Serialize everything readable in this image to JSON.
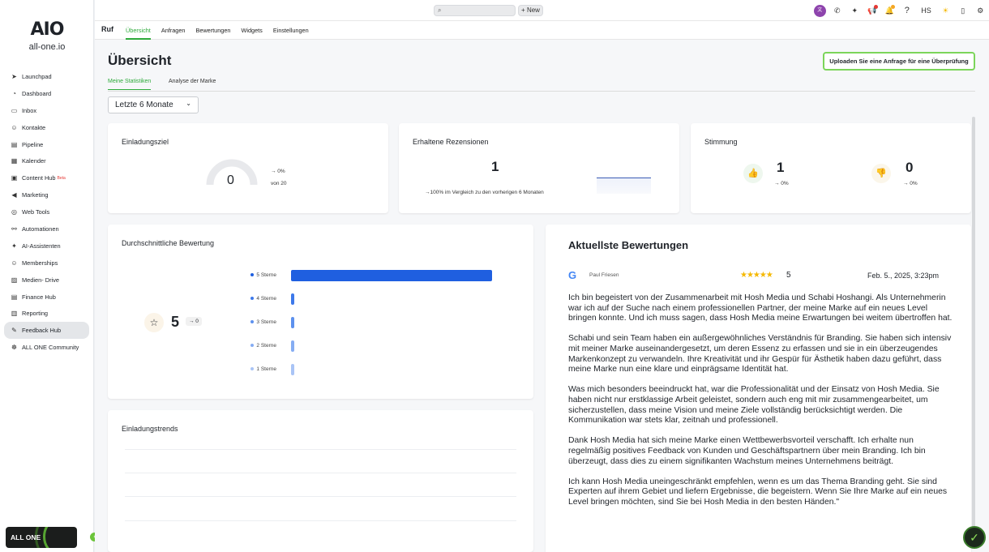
{
  "brand": {
    "logo_mark": "AIO",
    "logo_sub": "all-one.io"
  },
  "sidebar": {
    "items": [
      {
        "label": "Launchpad",
        "icon": "rocket-icon"
      },
      {
        "label": "Dashboard",
        "icon": "gauge-icon"
      },
      {
        "label": "Inbox",
        "icon": "chat-icon"
      },
      {
        "label": "Kontakte",
        "icon": "people-icon"
      },
      {
        "label": "Pipeline",
        "icon": "pipeline-icon"
      },
      {
        "label": "Kalender",
        "icon": "calendar-icon"
      },
      {
        "label": "Content Hub",
        "icon": "content-icon",
        "badge": "Beta"
      },
      {
        "label": "Marketing",
        "icon": "megaphone-icon"
      },
      {
        "label": "Web Tools",
        "icon": "globe-icon"
      },
      {
        "label": "Automationen",
        "icon": "automation-icon"
      },
      {
        "label": "AI-Assistenten",
        "icon": "sparkle-icon"
      },
      {
        "label": "Memberships",
        "icon": "members-icon"
      },
      {
        "label": "Medien- Drive",
        "icon": "image-icon"
      },
      {
        "label": "Finance Hub",
        "icon": "finance-icon"
      },
      {
        "label": "Reporting",
        "icon": "report-icon"
      },
      {
        "label": "Feedback Hub",
        "icon": "feedback-icon",
        "active": true
      },
      {
        "label": "ALL ONE Community",
        "icon": "community-icon"
      }
    ],
    "banner": "ALL ONE"
  },
  "topbar": {
    "new_label": "+ New",
    "user_initials": "HS"
  },
  "subnav": {
    "title": "Ruf",
    "tabs": [
      "Übersicht",
      "Anfragen",
      "Bewertungen",
      "Widgets",
      "Einstellungen"
    ]
  },
  "page": {
    "title": "Übersicht",
    "upload_label": "Uploaden Sie eine Anfrage für eine Überprüfung",
    "tabs": [
      "Meine Statistiken",
      "Analyse der Marke"
    ],
    "period": "Letzte 6 Monate"
  },
  "cards": {
    "invite": {
      "title": "Einladungsziel",
      "value": "0",
      "trend": "→ 0%",
      "of": "von 20",
      "progress": 0
    },
    "received": {
      "title": "Erhaltene Rezensionen",
      "value": "1",
      "compare": "→100% im Vergleich zu den vorherigen 6 Monaten"
    },
    "mood": {
      "title": "Stimmung",
      "positive": "1",
      "positive_trend": "→ 0%",
      "negative": "0",
      "negative_trend": "→ 0%"
    },
    "avg": {
      "title": "Durchschnittliche Bewertung",
      "value": "5",
      "trend": "→ 0"
    },
    "trends": {
      "title": "Einladungstrends"
    }
  },
  "chart_data": {
    "type": "bar",
    "categories": [
      "5 Sterne",
      "4 Sterne",
      "3 Sterne",
      "2 Sterne",
      "1 Sterne"
    ],
    "values": [
      1,
      0,
      0,
      0,
      0
    ],
    "colors": [
      "#1f5fe0",
      "#3d79ea",
      "#5d91ee",
      "#86adf3",
      "#a9c4f6"
    ]
  },
  "review": {
    "title": "Aktuellste Bewertungen",
    "author": "Paul Friesen",
    "stars": "★★★★★",
    "score": "5",
    "date": "Feb. 5., 2025, 3:23pm",
    "paragraphs": [
      "Ich bin begeistert von der Zusammenarbeit mit Hosh Media und Schabi Hoshangi. Als Unternehmerin war ich auf der Suche nach einem professionellen Partner, der meine Marke auf ein neues Level bringen konnte. Und ich muss sagen, dass Hosh Media meine Erwartungen bei weitem übertroffen hat.",
      "Schabi und sein Team haben ein außergewöhnliches Verständnis für Branding. Sie haben sich intensiv mit meiner Marke auseinandergesetzt, um deren Essenz zu erfassen und sie in ein überzeugendes Markenkonzept zu verwandeln. Ihre Kreativität und ihr Gespür für Ästhetik haben dazu geführt, dass meine Marke nun eine klare und einprägsame Identität hat.",
      "Was mich besonders beeindruckt hat, war die Professionalität und der Einsatz von Hosh Media. Sie haben nicht nur erstklassige Arbeit geleistet, sondern auch eng mit mir zusammengearbeitet, um sicherzustellen, dass meine Vision und meine Ziele vollständig berücksichtigt werden. Die Kommunikation war stets klar, zeitnah und professionell.",
      "Dank Hosh Media hat sich meine Marke einen Wettbewerbsvorteil verschafft. Ich erhalte nun regelmäßig positives Feedback von Kunden und Geschäftspartnern über mein Branding. Ich bin überzeugt, dass dies zu einem signifikanten Wachstum meines Unternehmens beiträgt.",
      "Ich kann Hosh Media uneingeschränkt empfehlen, wenn es um das Thema Branding geht. Sie sind Experten auf ihrem Gebiet und liefern Ergebnisse, die begeistern. Wenn Sie Ihre Marke auf ein neues Level bringen möchten, sind Sie bei Hosh Media in den besten Händen.\""
    ]
  }
}
